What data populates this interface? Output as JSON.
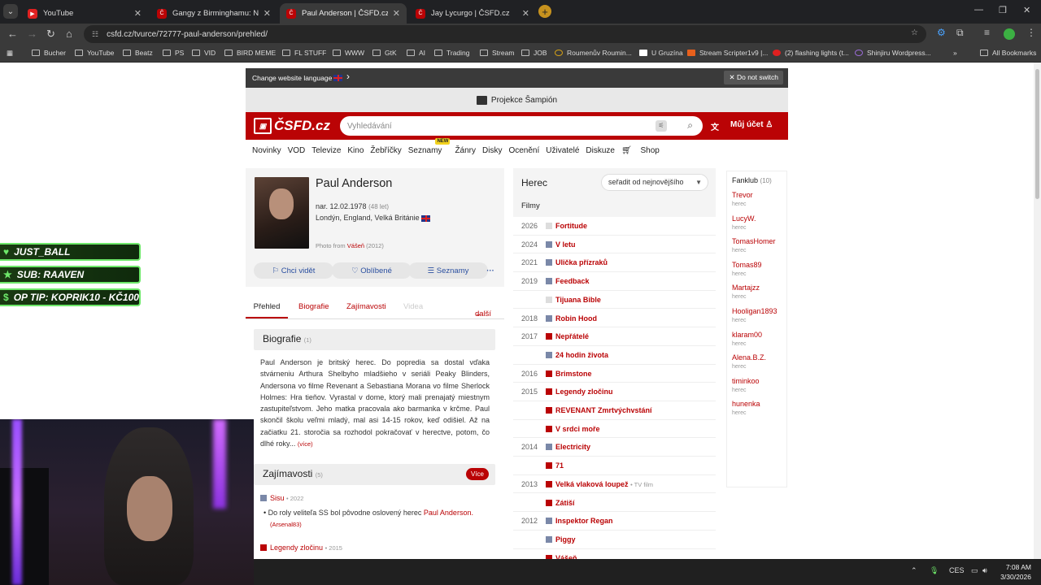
{
  "browser": {
    "tabs": [
      {
        "title": "YouTube",
        "favicon_color": "#e02020"
      },
      {
        "title": "Gangy z Birminghamu: Nesmrtel",
        "favicon_color": "#ba0305"
      },
      {
        "title": "Paul Anderson | ČSFD.cz",
        "favicon_color": "#ba0305"
      },
      {
        "title": "Jay Lycurgo | ČSFD.cz",
        "favicon_color": "#ba0305"
      }
    ],
    "new_tab": "+",
    "url": "csfd.cz/tvurce/72777-paul-anderson/prehled/",
    "bookmarks": [
      "Bucher",
      "YouTube",
      "Beatz",
      "PS",
      "VID",
      "BIRD MEME",
      "FL STUFF",
      "WWW",
      "GtK",
      "AI",
      "Trading",
      "Stream",
      "JOB",
      "Roumenův Roumin...",
      "U Gruzína",
      "Stream Scripter1v9 |...",
      "(2) flashing lights (t...",
      "Shinjiru Wordpress...",
      "All Bookmarks"
    ]
  },
  "langbar": {
    "label": "Change website language",
    "dismiss": "Do not switch"
  },
  "promo": {
    "text": "Projekce Šampión"
  },
  "header": {
    "logo": "ČSFD.cz",
    "search_placeholder": "Vyhledávání",
    "account": "Můj účet"
  },
  "menu": [
    "Novinky",
    "VOD",
    "Televize",
    "Kino",
    "Žebříčky",
    "Seznamy",
    "Žánry",
    "Disky",
    "Ocenění",
    "Uživatelé",
    "Diskuze",
    "Shop"
  ],
  "menu_new_badge": "NEW",
  "profile": {
    "name": "Paul Anderson",
    "born": "nar. 12.02.1978",
    "age": "(48 let)",
    "place": "Londýn, England, Velká Británie",
    "photo_from_label": "Photo from",
    "photo_from_film": "Vášeň",
    "photo_from_year": "(2012)",
    "buttons": {
      "watch": "Chci vidět",
      "fav": "Oblíbené",
      "lists": "Seznamy"
    }
  },
  "tabs": {
    "overview": "Přehled",
    "bio": "Biografie",
    "trivia": "Zajímavosti",
    "videos": "Videa",
    "more": "další"
  },
  "biography": {
    "title": "Biografie",
    "count": "(1)",
    "text": "Paul Anderson je britský herec. Do popredia sa dostal vďaka stvárneniu Arthura Shelbyho mladšieho v seriáli Peaky Blinders, Andersona vo filme Revenant a Sebastiana Morana vo filme Sherlock Holmes: Hra tieňov.  Vyrastal v dome, ktorý mali prenajatý miestnym zastupiteľstvom. Jeho matka pracovala ako barmanka v krčme. Paul skončil školu veľmi mladý, mal asi 14-15 rokov, keď odišiel. Až na začiatku 21. storočia sa rozhodol pokračovať v herectve, potom, čo dlhé roky...",
    "more": "(více)"
  },
  "trivia": {
    "title": "Zajímavosti",
    "count": "(5)",
    "more_btn": "Více",
    "items": [
      {
        "film": "Sisu",
        "year": "2022",
        "text": "Do roly veliteľa SS bol pôvodne oslovený herec",
        "link": "Paul Anderson.",
        "author": "(Arsenal83)"
      },
      {
        "film": "Legendy zločinu",
        "year": "2015"
      }
    ]
  },
  "filmography": {
    "role": "Herec",
    "sort": "seřadit od nejnovějšího",
    "section": "Filmy",
    "rows": [
      {
        "year": "2026",
        "title": "Fortitude",
        "color": "g"
      },
      {
        "year": "2024",
        "title": "V letu",
        "color": "b"
      },
      {
        "year": "2021",
        "title": "Ulička přízraků",
        "color": "b"
      },
      {
        "year": "2019",
        "title": "Feedback",
        "color": "b"
      },
      {
        "year": "",
        "title": "Tijuana Bible",
        "color": "g"
      },
      {
        "year": "2018",
        "title": "Robin Hood",
        "color": "b"
      },
      {
        "year": "2017",
        "title": "Nepřátelé",
        "color": "r"
      },
      {
        "year": "",
        "title": "24 hodin života",
        "color": "b"
      },
      {
        "year": "2016",
        "title": "Brimstone",
        "color": "r"
      },
      {
        "year": "2015",
        "title": "Legendy zločinu",
        "color": "r"
      },
      {
        "year": "",
        "title": "REVENANT Zmrtvýchvstání",
        "color": "r"
      },
      {
        "year": "",
        "title": "V srdci moře",
        "color": "r"
      },
      {
        "year": "2014",
        "title": "Electricity",
        "color": "b"
      },
      {
        "year": "",
        "title": "71",
        "color": "r"
      },
      {
        "year": "2013",
        "title": "Velká vlaková loupež",
        "color": "r",
        "meta": "TV film"
      },
      {
        "year": "",
        "title": "Zátiší",
        "color": "r"
      },
      {
        "year": "2012",
        "title": "Inspektor Regan",
        "color": "b"
      },
      {
        "year": "",
        "title": "Piggy",
        "color": "b"
      },
      {
        "year": "",
        "title": "Vášeň",
        "color": "r"
      }
    ]
  },
  "fanclub": {
    "title": "Fanklub",
    "count": "(10)",
    "members": [
      {
        "user": "Trevor",
        "role": "herec"
      },
      {
        "user": "LucyW.",
        "role": "herec"
      },
      {
        "user": "TomasHomer",
        "role": "herec"
      },
      {
        "user": "Tomas89",
        "role": "herec"
      },
      {
        "user": "Martajzz",
        "role": "herec"
      },
      {
        "user": "Hooligan1893",
        "role": "herec"
      },
      {
        "user": "klaram00",
        "role": "herec"
      },
      {
        "user": "Alena.B.Z.",
        "role": "herec"
      },
      {
        "user": "timinkoo",
        "role": "herec"
      },
      {
        "user": "hunenka",
        "role": "herec"
      }
    ]
  },
  "stream_overlay": {
    "follower": "JUST_BALL",
    "sub": "SUB: RAAVEN",
    "tip": "OP TIP: KOPRIK10 - KČ100"
  },
  "taskbar": {
    "lang": "CES",
    "time": "7:08 AM",
    "date": "3/30/2026"
  },
  "colors": {
    "brand": "#ba0305",
    "overlay_green": "#6ee86a"
  }
}
